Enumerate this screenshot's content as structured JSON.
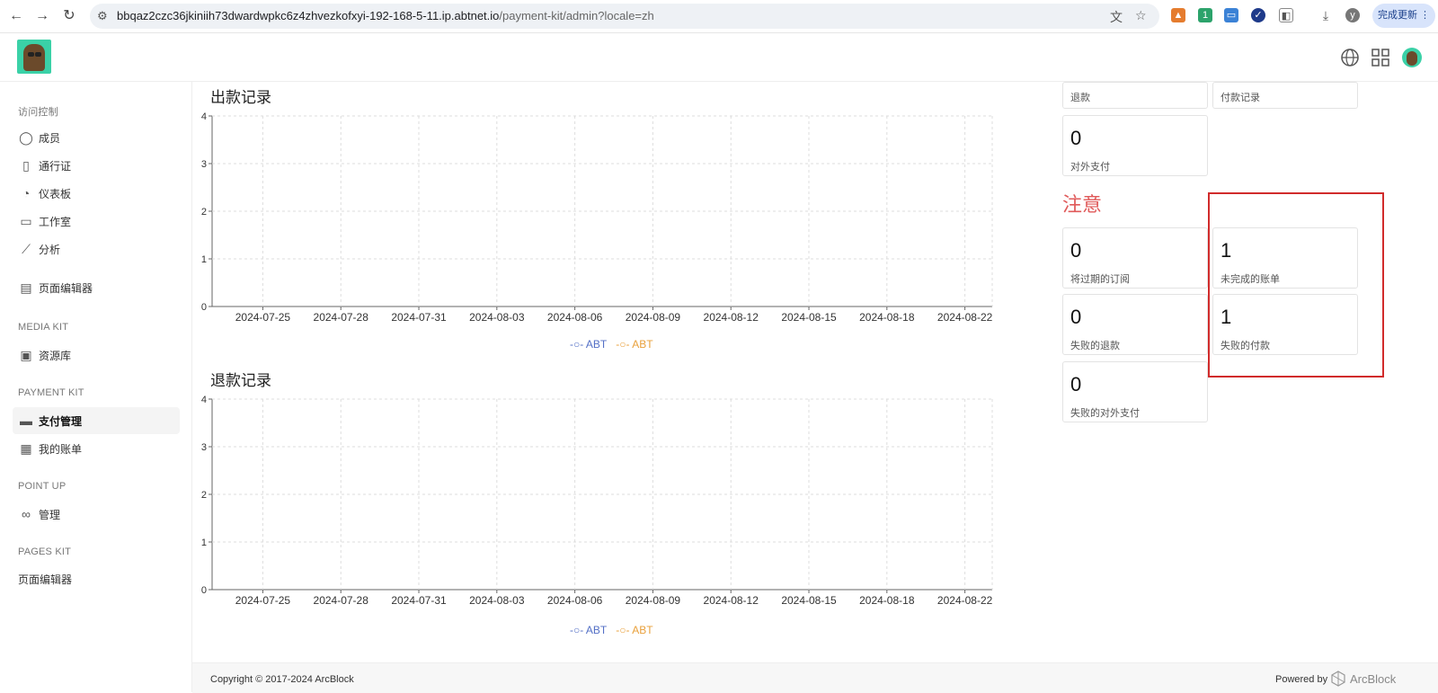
{
  "browser": {
    "url_host": "bbqaz2czc36jkiniih73dwardwpkc6z4zhvezkofxyi-192-168-5-11.ip.abtnet.io",
    "url_path": "/payment-kit/admin?locale=zh",
    "profile_initial": "y",
    "update_label": "完成更新",
    "ext_badge": "1"
  },
  "sidebar": {
    "sections": [
      {
        "title": "访问控制",
        "items": [
          "成员",
          "通行证",
          "仪表板",
          "工作室",
          "分析"
        ]
      },
      {
        "title": "",
        "items": [
          "页面编辑器"
        ]
      },
      {
        "title": "MEDIA KIT",
        "items": [
          "资源库"
        ]
      },
      {
        "title": "PAYMENT KIT",
        "items": [
          "支付管理",
          "我的账单"
        ]
      },
      {
        "title": "POINT UP",
        "items": [
          "管理"
        ]
      },
      {
        "title": "PAGES KIT",
        "items": [
          "页面编辑器"
        ]
      }
    ],
    "active_item": "支付管理"
  },
  "icons": [
    "translate-icon",
    "star-icon",
    "globe-icon",
    "grid-icon",
    "user-icon",
    "badge-icon",
    "gauge-icon",
    "studio-icon",
    "analytics-icon",
    "page-editor-icon",
    "media-icon",
    "card-icon",
    "receipt-icon",
    "infinity-icon"
  ],
  "chart_data": [
    {
      "type": "line",
      "title": "出款记录",
      "categories": [
        "2024-07-25",
        "2024-07-28",
        "2024-07-31",
        "2024-08-03",
        "2024-08-06",
        "2024-08-09",
        "2024-08-12",
        "2024-08-15",
        "2024-08-18",
        "2024-08-22"
      ],
      "yticks": [
        0,
        1,
        2,
        3,
        4
      ],
      "ylim": [
        0,
        4
      ],
      "series": [
        {
          "name": "ABT",
          "values": []
        },
        {
          "name": "ABT",
          "values": []
        }
      ],
      "grid": true,
      "legend": "bottom-center",
      "colors": [
        "#5470c6",
        "#e9a03b"
      ]
    },
    {
      "type": "line",
      "title": "退款记录",
      "categories": [
        "2024-07-25",
        "2024-07-28",
        "2024-07-31",
        "2024-08-03",
        "2024-08-06",
        "2024-08-09",
        "2024-08-12",
        "2024-08-15",
        "2024-08-18",
        "2024-08-22"
      ],
      "yticks": [
        0,
        1,
        2,
        3,
        4
      ],
      "ylim": [
        0,
        4
      ],
      "series": [
        {
          "name": "ABT",
          "values": []
        },
        {
          "name": "ABT",
          "values": []
        }
      ],
      "grid": true,
      "legend": "bottom-center",
      "colors": [
        "#5470c6",
        "#e9a03b"
      ]
    }
  ],
  "stats": {
    "top_partial": [
      "退款",
      "付款记录"
    ],
    "payout": {
      "value": "0",
      "label": "对外支付"
    },
    "notice_title": "注意",
    "notice_cards": [
      {
        "value": "0",
        "label": "将过期的订阅"
      },
      {
        "value": "1",
        "label": "未完成的账单"
      },
      {
        "value": "0",
        "label": "失败的退款"
      },
      {
        "value": "1",
        "label": "失败的付款"
      },
      {
        "value": "0",
        "label": "失败的对外支付"
      }
    ]
  },
  "footer": {
    "copyright": "Copyright © 2017-2024  ArcBlock",
    "powered": "Powered by",
    "brand": "ArcBlock"
  },
  "colors": {
    "notice": "#e05a5a",
    "highlight": "#d12b2b",
    "series1": "#5470c6",
    "series2": "#e9a03b"
  }
}
